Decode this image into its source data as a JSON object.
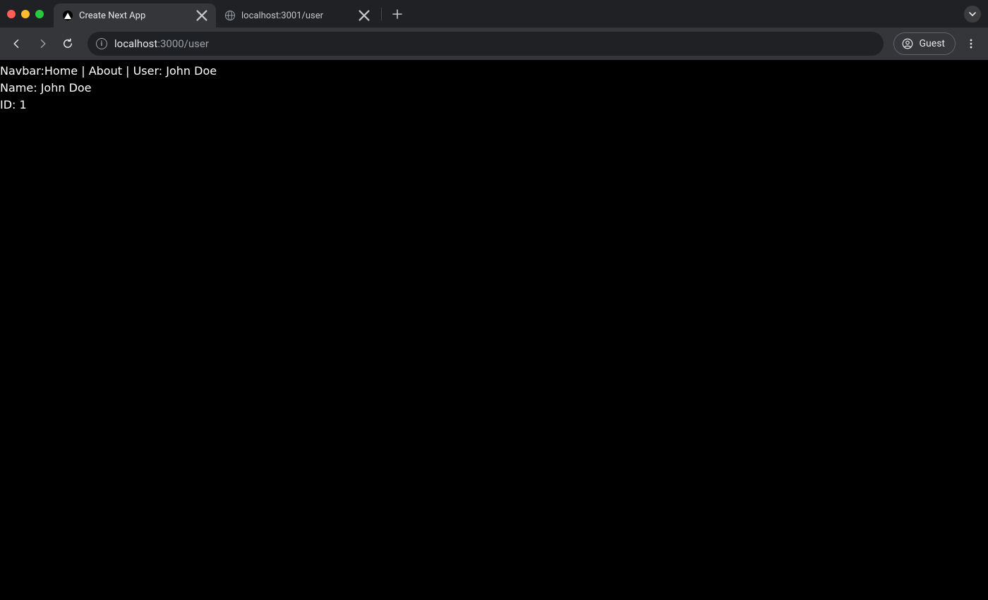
{
  "browser": {
    "tabs": [
      {
        "title": "Create Next App",
        "favicon": "next"
      },
      {
        "title": "localhost:3001/user",
        "favicon": "globe"
      }
    ],
    "active_tab_index": 0,
    "address": {
      "host": "localhost",
      "port_path": ":3000/user"
    },
    "profile_label": "Guest"
  },
  "page": {
    "navbar": {
      "prefix": "Navbar:",
      "links": [
        "Home",
        "About"
      ],
      "user_label": "User:",
      "user_name": "John Doe"
    },
    "details": {
      "name_label": "Name:",
      "name_value": "John Doe",
      "id_label": "ID:",
      "id_value": "1"
    }
  }
}
